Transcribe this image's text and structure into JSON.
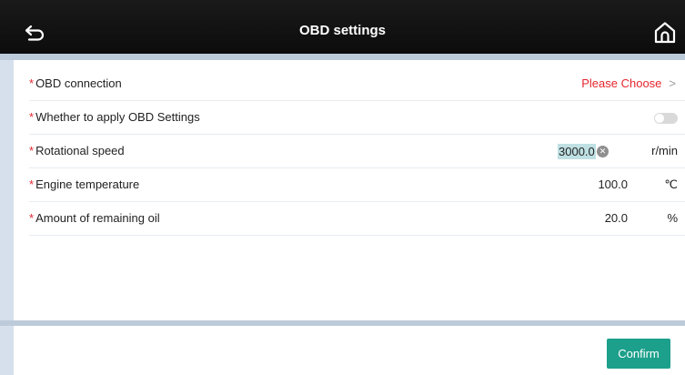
{
  "header": {
    "title": "OBD settings",
    "back_icon": "back-arrow-icon",
    "home_icon": "home-icon"
  },
  "form": {
    "required_mark": "*",
    "rows": [
      {
        "label": "OBD connection",
        "value": "Please Choose",
        "chevron": ">"
      },
      {
        "label": "Whether to apply OBD Settings",
        "toggle_on": false
      },
      {
        "label": "Rotational speed",
        "value": "3000.0",
        "unit": "r/min"
      },
      {
        "label": "Engine temperature",
        "value": "100.0",
        "unit": "℃"
      },
      {
        "label": "Amount of remaining oil",
        "value": "20.0",
        "unit": "%"
      }
    ]
  },
  "footer": {
    "confirm_label": "Confirm"
  },
  "colors": {
    "accent": "#1c9f8b",
    "required": "#e5262d",
    "header_bg": "#111111",
    "page_bg": "#d5e0ec"
  }
}
